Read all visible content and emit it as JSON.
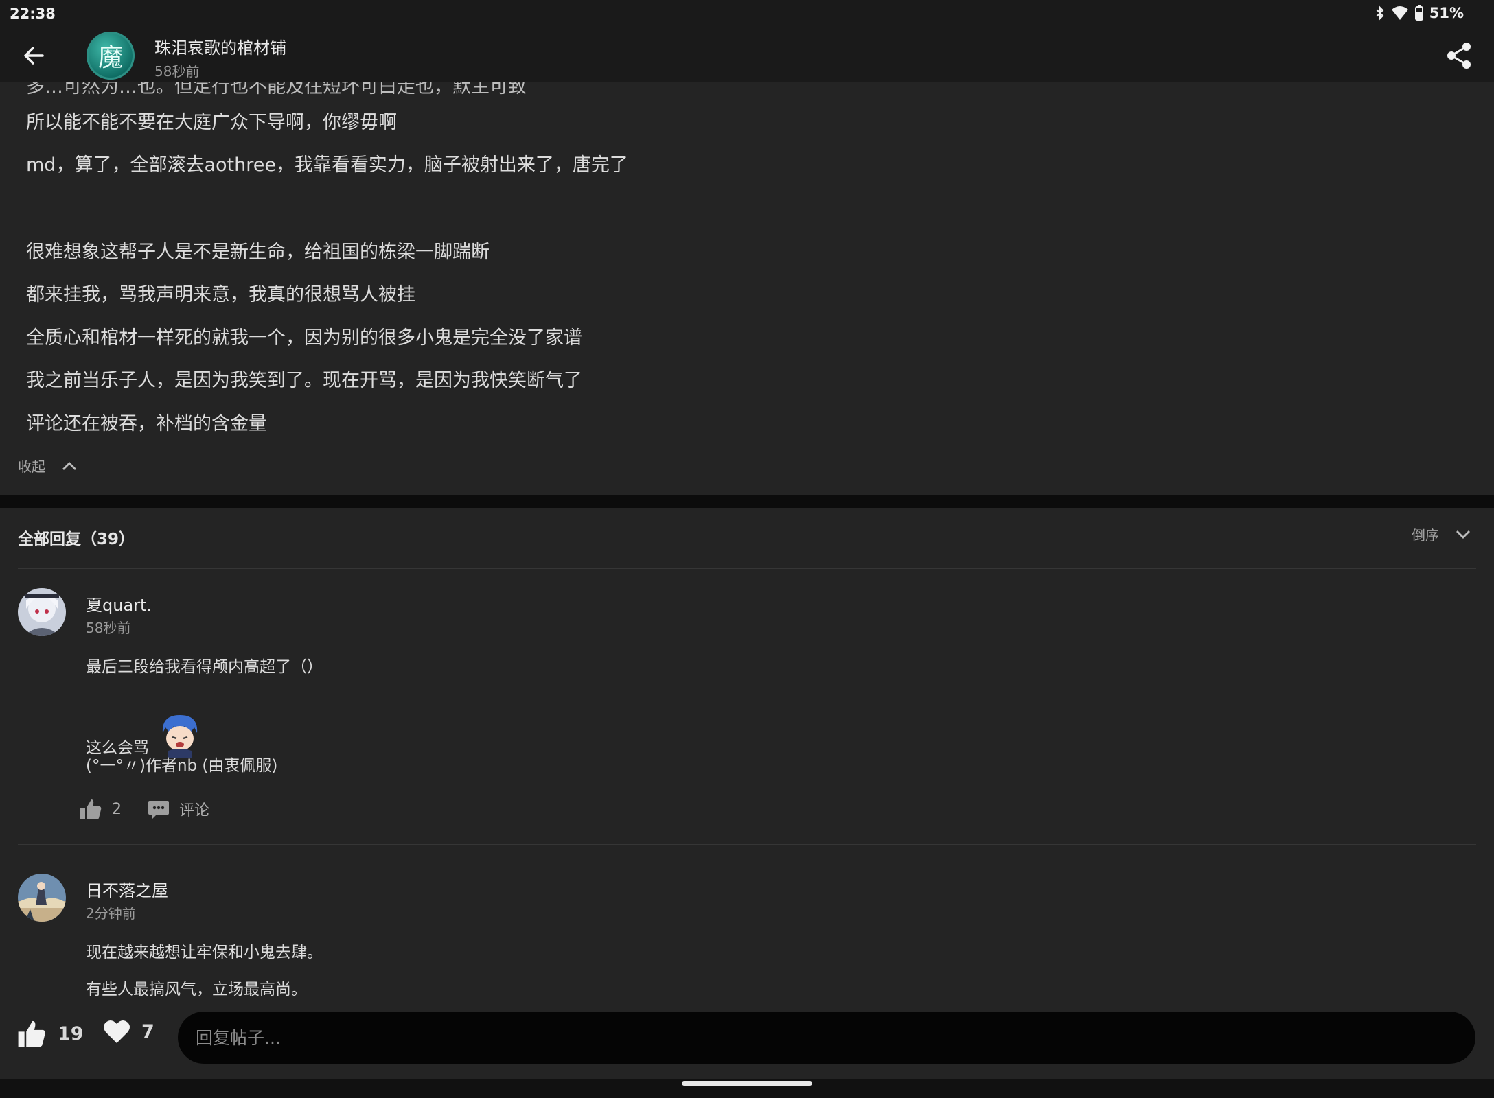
{
  "status_bar": {
    "time": "22:38",
    "battery": "51%"
  },
  "header": {
    "author": "珠泪哀歌的棺材铺",
    "time": "58秒前",
    "avatar_glyph": "魔"
  },
  "post": {
    "partial_line": "多…可然为…也。但定行也不能及往短坏可白走也，默主可致",
    "lines": [
      "所以能不能不要在大庭广众下导啊，你缪毋啊",
      "md，算了，全部滚去aothree，我靠看看实力，脑子被射出来了，唐完了",
      "很难想象这帮子人是不是新生命，给祖国的栋梁一脚踹断",
      "都来挂我，骂我声明来意，我真的很想骂人被挂",
      "全质心和棺材一样死的就我一个，因为别的很多小鬼是完全没了家谱",
      "我之前当乐子人，是因为我笑到了。现在开骂，是因为我快笑断气了",
      "评论还在被吞，补档的含金量"
    ],
    "collapse_label": "收起"
  },
  "replies": {
    "title": "全部回复（39）",
    "sort_label": "倒序",
    "comments": [
      {
        "name": "夏quart.",
        "time": "58秒前",
        "lines": [
          "最后三段给我看得颅内高超了（）",
          "这么会骂",
          "(°一°〃)作者nb (由衷佩服)"
        ],
        "likes": "2",
        "comment_label": "评论"
      },
      {
        "name": "日不落之屋",
        "time": "2分钟前",
        "lines": [
          "现在越来越想让牢保和小鬼去肆。",
          "有些人最搞风气，立场最高尚。"
        ]
      }
    ]
  },
  "bottom_bar": {
    "likes": "19",
    "favorites": "7",
    "reply_placeholder": "回复帖子..."
  },
  "colors": {
    "background": "#242424",
    "bar": "#1a1a1a",
    "input": "#050505",
    "accent_avatar": "#1f8f82"
  },
  "icons": [
    "back-arrow-icon",
    "share-icon",
    "chevron-up-icon",
    "chevron-down-icon",
    "thumbs-up-icon",
    "comment-icon",
    "heart-icon",
    "bluetooth-icon",
    "wifi-icon",
    "battery-icon"
  ]
}
